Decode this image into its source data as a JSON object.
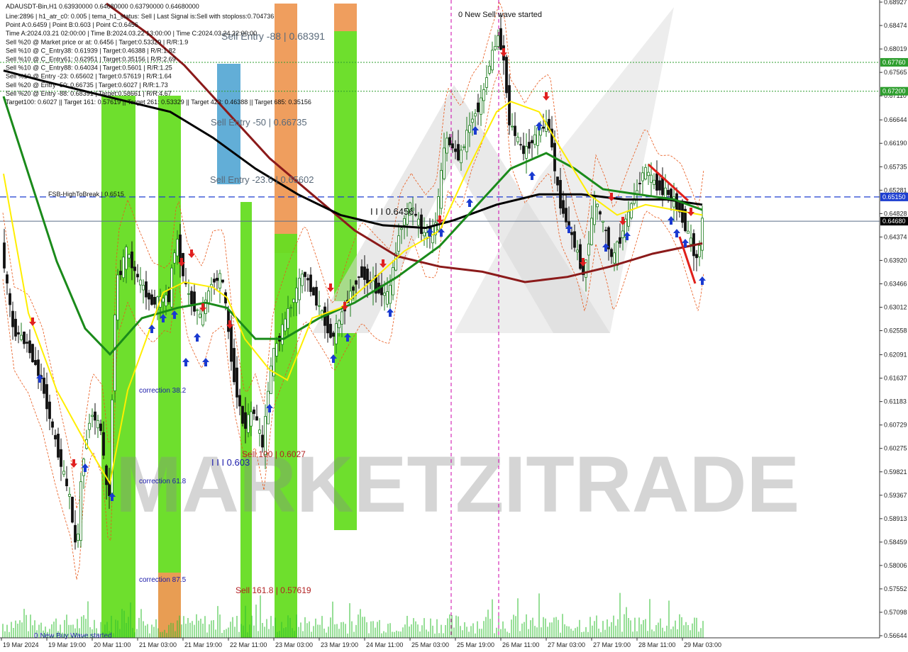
{
  "chart_data": {
    "type": "candlestick",
    "symbol_line": "ADAUSDT-Bin,H1  0.63930000 0.64680000 0.63790000 0.64680000",
    "info_lines": [
      "Line:2896 | h1_atr_c0: 0.005 | tema_h1_status: Sell | Last Signal is:Sell with stoploss:0.704736",
      "Point A:0.6459 | Point B:0.603 | Point C:0.6456",
      "Time A:2024.03.21 02:00:00 | Time B:2024.03.22 13:00:00 | Time C:2024.03.24 22:00:00",
      "Sell %20 @ Market price or at: 0.6456 | Target:0.53329 | R/R:1.9",
      "Sell %10 @ C_Entry38: 0.61939 | Target:0.46388 | R/R:1.82",
      "Sell %10 @ C_Entry61: 0.62951 | Target:0.35156 | R/R:2.69",
      "Sell %10 @ C_Entry88: 0.64034 | Target:0.5601 | R/R:1.25",
      "Sell %10 @ Entry -23: 0.65602 | Target:0.57619 | R/R:1.64",
      "Sell %20 @ Entry -50: 0.66735 | Target:0.6027 | R/R:1.73",
      "Sell %20 @ Entry -88: 0.68391 | Target:0.58661 | R/R:4.67",
      "Target100: 0.6027 || Target 161: 0.57619 || Target 261: 0.53329 || Target 423: 0.46388 || Target 685: 0.35156"
    ],
    "y_ticks": [
      "0.68927",
      "0.68474",
      "0.68019",
      "0.67565",
      "0.67110",
      "0.66644",
      "0.66190",
      "0.65735",
      "0.65281",
      "0.64828",
      "0.64374",
      "0.63920",
      "0.63466",
      "0.63012",
      "0.62558",
      "0.62091",
      "0.61637",
      "0.61183",
      "0.60729",
      "0.60275",
      "0.59821",
      "0.59367",
      "0.58913",
      "0.58459",
      "0.58006",
      "0.57552",
      "0.57098",
      "0.56644"
    ],
    "ylim": [
      0.56644,
      0.68927
    ],
    "x_ticks": [
      "19 Mar 2024",
      "19 Mar 19:00",
      "20 Mar 11:00",
      "21 Mar 03:00",
      "21 Mar 19:00",
      "22 Mar 11:00",
      "23 Mar 03:00",
      "23 Mar 19:00",
      "24 Mar 11:00",
      "25 Mar 03:00",
      "25 Mar 19:00",
      "26 Mar 11:00",
      "27 Mar 03:00",
      "27 Mar 19:00",
      "28 Mar 11:00",
      "29 Mar 03:00"
    ],
    "price_tags": [
      {
        "label": "0.67760",
        "value": 0.6776,
        "color": "#2e9e2e"
      },
      {
        "label": "0.67200",
        "value": 0.672,
        "color": "#2e9e2e"
      },
      {
        "label": "0.65150",
        "value": 0.6515,
        "color": "#1e3fd0"
      },
      {
        "label": "0.64680",
        "value": 0.6468,
        "color": "#000000"
      }
    ],
    "annotations": [
      {
        "text": "Sell Entry -88 | 0.68391",
        "color": "#5a6a7a"
      },
      {
        "text": "Sell Entry -50 | 0.66735",
        "color": "#5a6a7a"
      },
      {
        "text": "Sell Entry -23.6 | 0.65602",
        "color": "#5a6a7a"
      },
      {
        "text": "FSB-HighToBreak | 0.6515",
        "color": "#111111"
      },
      {
        "text": "I I I 0.6456",
        "color": "#111111"
      },
      {
        "text": "I I I 0.603",
        "color": "#1a1aaa"
      },
      {
        "text": "Sell 100 | 0.6027",
        "color": "#b22222"
      },
      {
        "text": "Sell 161.8 | 0.57619",
        "color": "#b22222"
      },
      {
        "text": "correction 38.2",
        "color": "#1a1aaa"
      },
      {
        "text": "correction 61.8",
        "color": "#1a1aaa"
      },
      {
        "text": "correction 87.5",
        "color": "#1a1aaa"
      },
      {
        "text": "0 New Sell wave started",
        "color": "#111111"
      },
      {
        "text": "0 New Buy Wave started",
        "color": "#1a1aaa"
      }
    ],
    "watermark": "MARKETZITRADE",
    "colors": {
      "bull": "#1a7a1a",
      "bear": "#111111",
      "ma_black": "#000000",
      "ma_darkred": "#8b1a1a",
      "ma_green": "#1a8a1a",
      "ma_yellow": "#ffee00",
      "zone_green": "#66dd22",
      "zone_orange": "#ee9955",
      "zone_blue": "#5aaad5",
      "signal_up": "#1a3ad0",
      "signal_down": "#e02020"
    }
  }
}
